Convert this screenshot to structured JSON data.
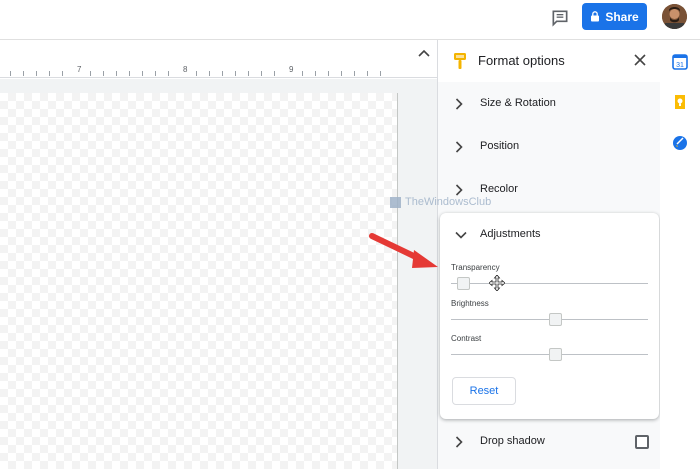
{
  "header": {
    "share_label": "Share",
    "icons": [
      "comment-icon",
      "lock-icon",
      "avatar"
    ]
  },
  "ruler": {
    "numbers": [
      "7",
      "8",
      "9"
    ]
  },
  "panel": {
    "title": "Format options",
    "sections": [
      {
        "label": "Size & Rotation",
        "expanded": false
      },
      {
        "label": "Position",
        "expanded": false
      },
      {
        "label": "Recolor",
        "expanded": false
      },
      {
        "label": "Adjustments",
        "expanded": true
      },
      {
        "label": "Drop shadow",
        "expanded": false
      }
    ],
    "adjustments": {
      "transparency_label": "Transparency",
      "transparency_value": 0.0,
      "brightness_label": "Brightness",
      "brightness_value": 0.5,
      "contrast_label": "Contrast",
      "contrast_value": 0.5,
      "reset_label": "Reset"
    },
    "drop_shadow_checked": false
  },
  "watermark": {
    "text": "TheWindowsClub"
  },
  "colors": {
    "accent": "#1a73e8",
    "arrow": "#e53935",
    "brush": "#f4b400"
  }
}
